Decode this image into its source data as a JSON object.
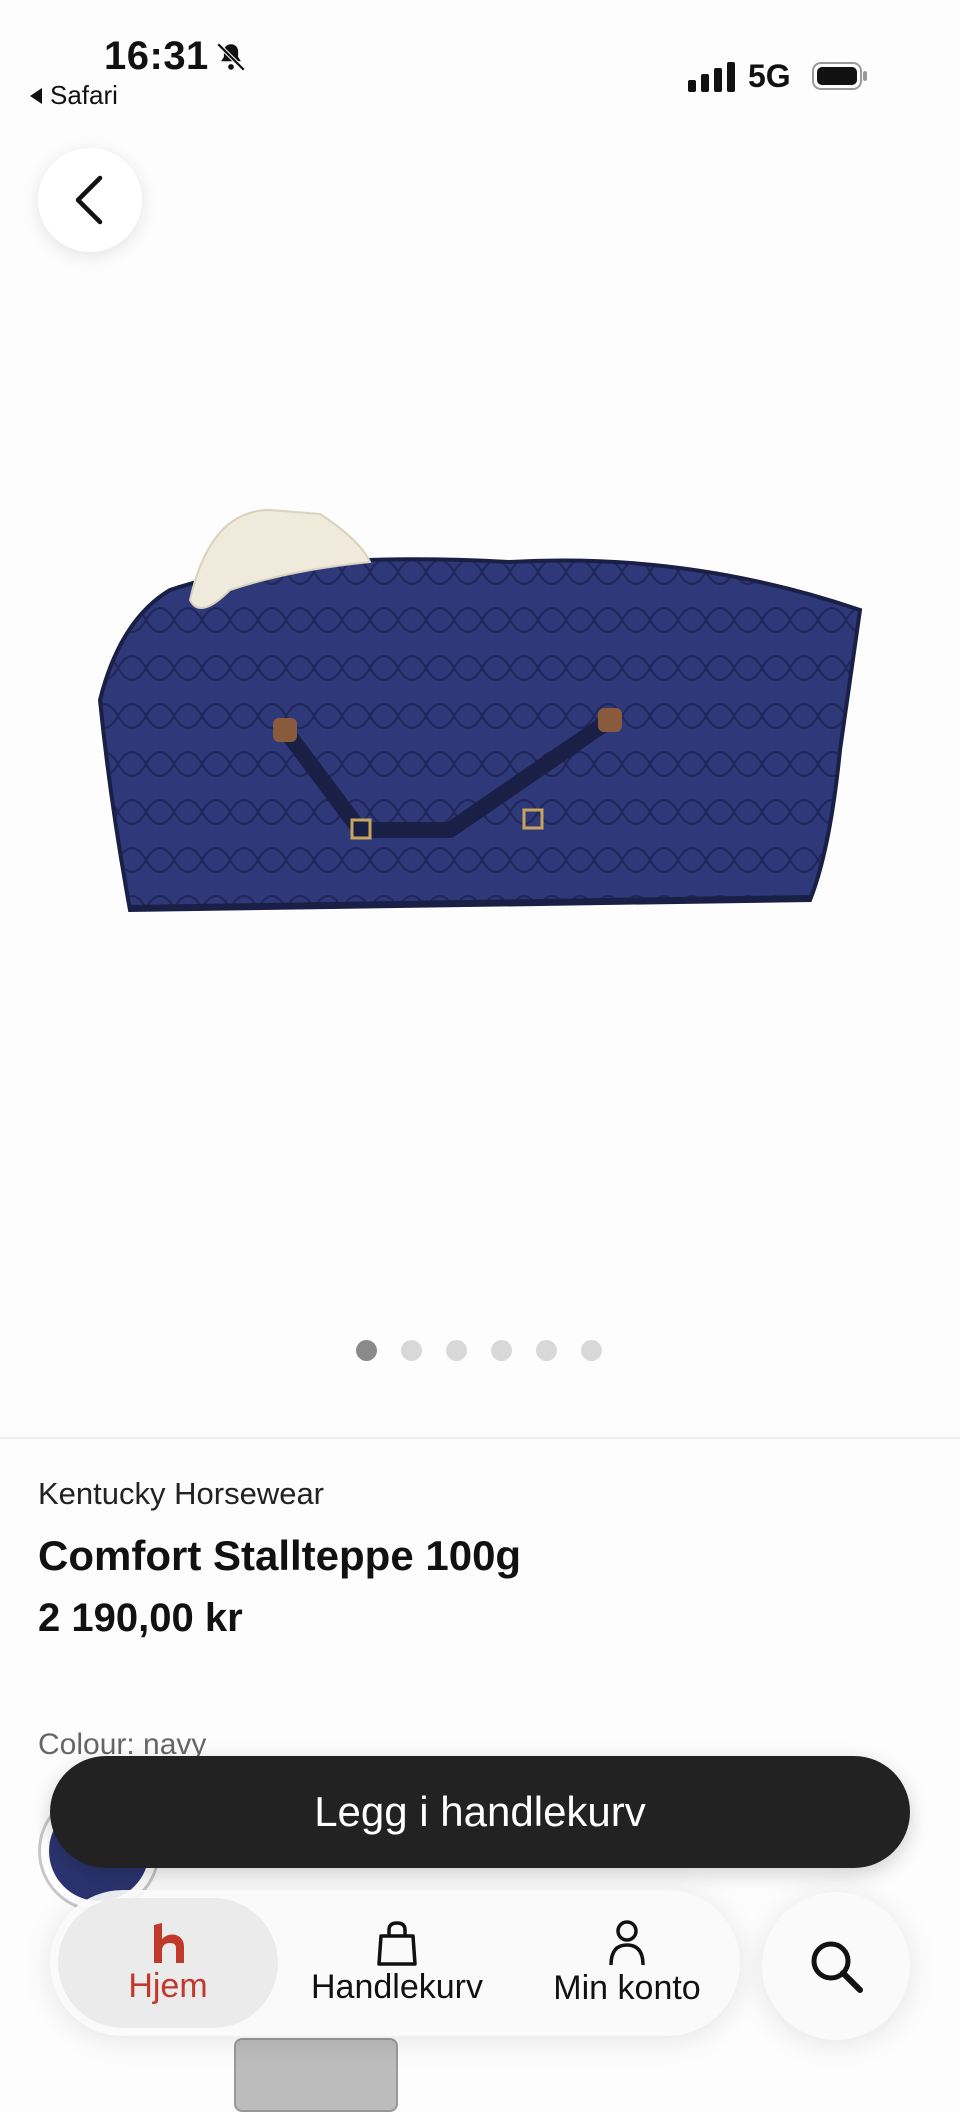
{
  "status_bar": {
    "time": "16:31",
    "back_app": "Safari",
    "network": "5G"
  },
  "icons": {
    "back": "chevron-left-icon",
    "bell": "bell-slash-icon",
    "home": "hooks-logo-icon",
    "cart": "shopping-bag-icon",
    "account": "person-icon",
    "search": "search-icon"
  },
  "carousel": {
    "count": 6,
    "active_index": 0
  },
  "product": {
    "brand": "Kentucky Horsewear",
    "title": "Comfort Stallteppe 100g",
    "price": "2 190,00 kr",
    "colour_label": "Colour: navy",
    "colour_hex": "#2c3470"
  },
  "cta": {
    "add_to_cart": "Legg i handlekurv"
  },
  "nav": {
    "items": [
      {
        "label": "Hjem",
        "active": true
      },
      {
        "label": "Handlekurv",
        "active": false
      },
      {
        "label": "Min konto",
        "active": false
      }
    ]
  },
  "colors": {
    "accent": "#c0392b",
    "button_dark": "#222222",
    "blanket_navy": "#2c3470",
    "fleece": "#efeadc"
  }
}
